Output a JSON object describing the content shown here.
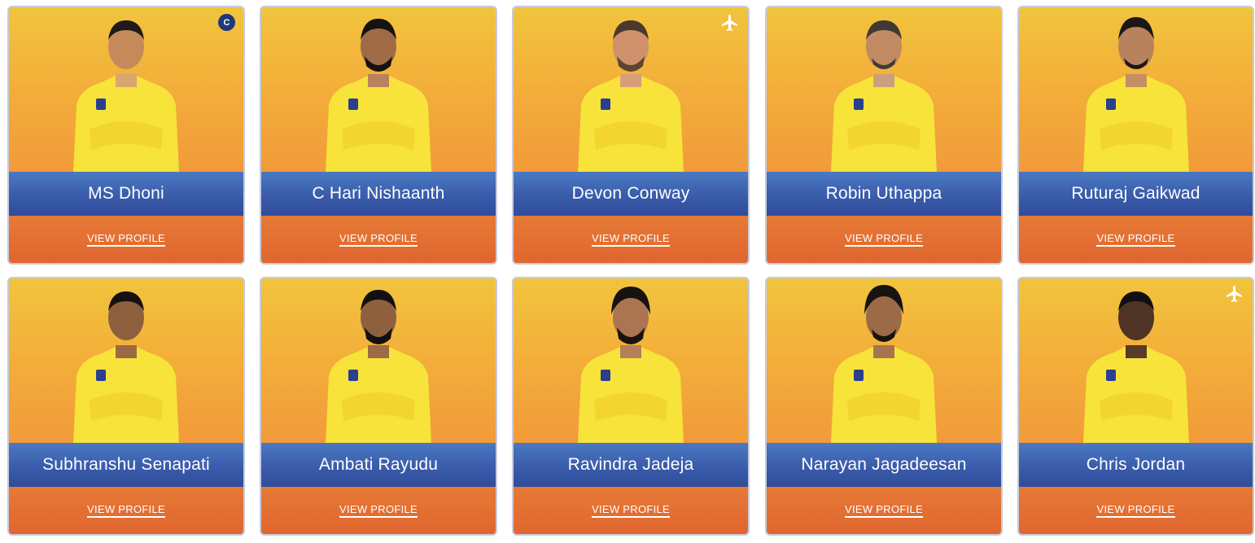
{
  "cards": [
    {
      "name": "MS Dhoni",
      "link": "VIEW PROFILE",
      "badge": "C",
      "icon": "captain-badge"
    },
    {
      "name": "C Hari Nishaanth",
      "link": "VIEW PROFILE"
    },
    {
      "name": "Devon Conway",
      "link": "VIEW PROFILE",
      "icon": "plane-icon"
    },
    {
      "name": "Robin Uthappa",
      "link": "VIEW PROFILE"
    },
    {
      "name": "Ruturaj Gaikwad",
      "link": "VIEW PROFILE"
    },
    {
      "name": "Subhranshu Senapati",
      "link": "VIEW PROFILE"
    },
    {
      "name": "Ambati Rayudu",
      "link": "VIEW PROFILE"
    },
    {
      "name": "Ravindra Jadeja",
      "link": "VIEW PROFILE"
    },
    {
      "name": "Narayan Jagadeesan",
      "link": "VIEW PROFILE"
    },
    {
      "name": "Chris Jordan",
      "link": "VIEW PROFILE",
      "icon": "plane-icon"
    }
  ],
  "colors": {
    "photo_bg_top": "#f1c43d",
    "photo_bg_bottom": "#f29a3a",
    "name_bar": "#3a5cab",
    "footer": "#e0662f",
    "jersey": "#f7e33a",
    "captain_badge": "#1f3a7a"
  }
}
